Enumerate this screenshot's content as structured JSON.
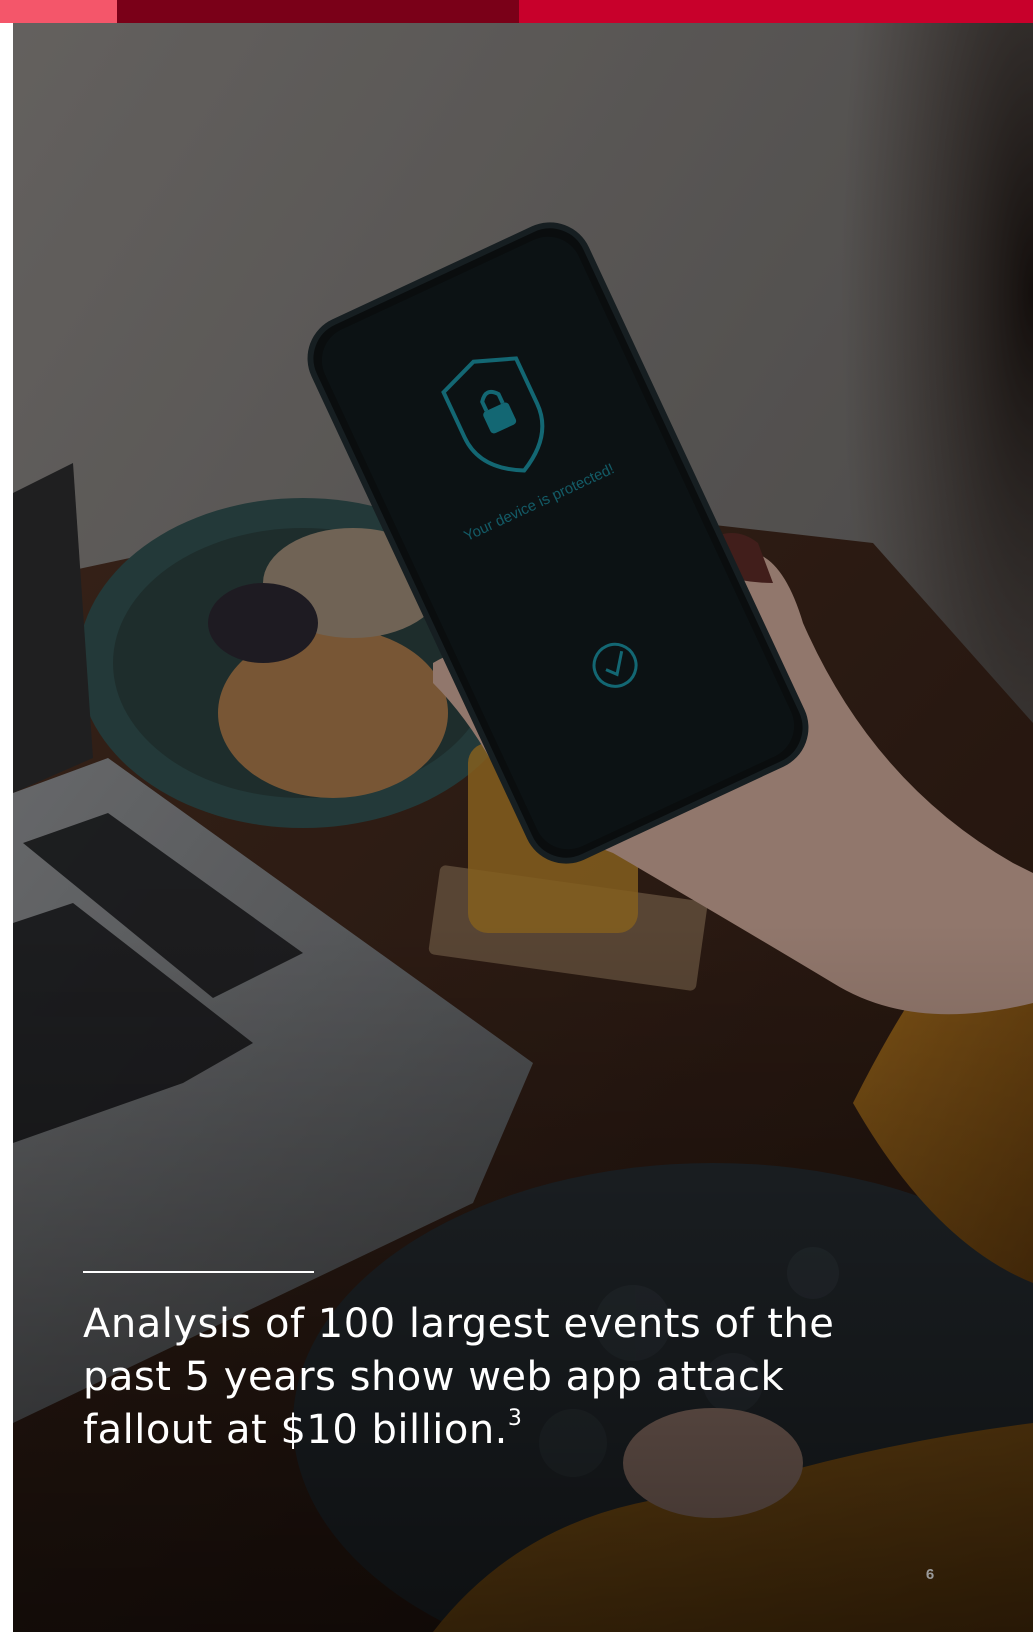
{
  "colors": {
    "bar_left": "#f4566a",
    "bar_mid": "#7a0018",
    "bar_right": "#c8002b",
    "overlay": "#000000"
  },
  "photo": {
    "subject": "hand holding smartphone with security screen",
    "screen_text": "Your device is protected!",
    "screen_icons": [
      "shield-lock-icon",
      "checkmark-circle-icon"
    ]
  },
  "headline": {
    "line1": "Analysis of 100 largest events of the",
    "line2": "past 5 years show web app attack",
    "line3": "fallout at $10 billion.",
    "footnote": "3"
  },
  "page_number": "6"
}
